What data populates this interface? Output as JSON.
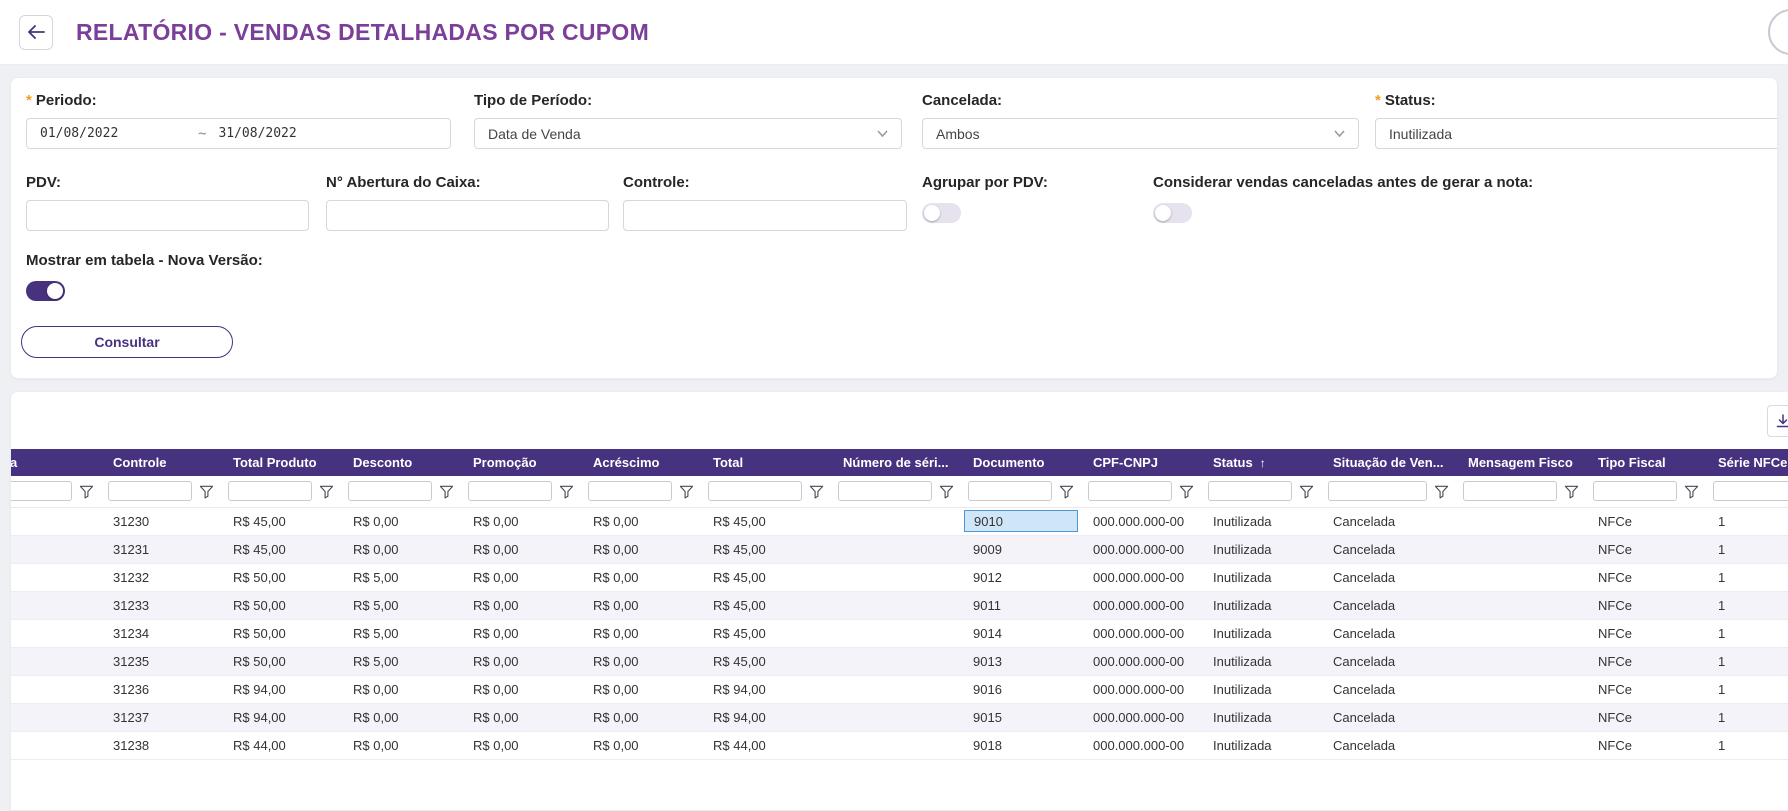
{
  "header": {
    "title": "RELATÓRIO - VENDAS DETALHADAS POR CUPOM"
  },
  "filters": {
    "required_mark": "*",
    "periodo": {
      "label": "Periodo:",
      "from": "01/08/2022",
      "separator": "~",
      "to": "31/08/2022"
    },
    "tipo_periodo": {
      "label": "Tipo de Período:",
      "value": "Data de Venda"
    },
    "cancelada": {
      "label": "Cancelada:",
      "value": "Ambos"
    },
    "status": {
      "label": "Status:",
      "value": "Inutilizada"
    },
    "pdv": {
      "label": "PDV:",
      "value": ""
    },
    "abertura_caixa": {
      "label": "N° Abertura do Caixa:",
      "value": ""
    },
    "controle": {
      "label": "Controle:",
      "value": ""
    },
    "agrupar_pdv": {
      "label": "Agrupar por PDV:",
      "enabled": false
    },
    "considerar_canceladas": {
      "label": "Considerar vendas canceladas antes de gerar a nota:",
      "enabled": false
    },
    "mostrar_tabela": {
      "label": "Mostrar em tabela - Nova Versão:",
      "enabled": true
    },
    "consultar_label": "Consultar"
  },
  "table": {
    "sort_arrow": "↑",
    "columns": [
      {
        "key": "abertura",
        "label": "Abertura"
      },
      {
        "key": "controle",
        "label": "Controle"
      },
      {
        "key": "total_produto",
        "label": "Total Produto"
      },
      {
        "key": "desconto",
        "label": "Desconto"
      },
      {
        "key": "promocao",
        "label": "Promoção"
      },
      {
        "key": "acrescimo",
        "label": "Acréscimo"
      },
      {
        "key": "total",
        "label": "Total"
      },
      {
        "key": "numero_serie",
        "label": "Número de séri..."
      },
      {
        "key": "documento",
        "label": "Documento"
      },
      {
        "key": "cpf_cnpj",
        "label": "CPF-CNPJ"
      },
      {
        "key": "status",
        "label": "Status",
        "sort": "asc"
      },
      {
        "key": "situacao_venda",
        "label": "Situação de Ven..."
      },
      {
        "key": "mensagem_fisco",
        "label": "Mensagem Fisco"
      },
      {
        "key": "tipo_fiscal",
        "label": "Tipo Fiscal"
      },
      {
        "key": "serie_nfce",
        "label": "Série NFCe"
      }
    ],
    "selected_cell": {
      "row_index": 0,
      "column_key": "documento"
    },
    "rows": [
      {
        "abertura": "",
        "controle": "31230",
        "total_produto": "R$ 45,00",
        "desconto": "R$ 0,00",
        "promocao": "R$ 0,00",
        "acrescimo": "R$ 0,00",
        "total": "R$ 45,00",
        "numero_serie": "",
        "documento": "9010",
        "cpf_cnpj": "000.000.000-00",
        "status": "Inutilizada",
        "situacao_venda": "Cancelada",
        "mensagem_fisco": "",
        "tipo_fiscal": "NFCe",
        "serie_nfce": "1"
      },
      {
        "abertura": "",
        "controle": "31231",
        "total_produto": "R$ 45,00",
        "desconto": "R$ 0,00",
        "promocao": "R$ 0,00",
        "acrescimo": "R$ 0,00",
        "total": "R$ 45,00",
        "numero_serie": "",
        "documento": "9009",
        "cpf_cnpj": "000.000.000-00",
        "status": "Inutilizada",
        "situacao_venda": "Cancelada",
        "mensagem_fisco": "",
        "tipo_fiscal": "NFCe",
        "serie_nfce": "1"
      },
      {
        "abertura": "",
        "controle": "31232",
        "total_produto": "R$ 50,00",
        "desconto": "R$ 5,00",
        "promocao": "R$ 0,00",
        "acrescimo": "R$ 0,00",
        "total": "R$ 45,00",
        "numero_serie": "",
        "documento": "9012",
        "cpf_cnpj": "000.000.000-00",
        "status": "Inutilizada",
        "situacao_venda": "Cancelada",
        "mensagem_fisco": "",
        "tipo_fiscal": "NFCe",
        "serie_nfce": "1"
      },
      {
        "abertura": "",
        "controle": "31233",
        "total_produto": "R$ 50,00",
        "desconto": "R$ 5,00",
        "promocao": "R$ 0,00",
        "acrescimo": "R$ 0,00",
        "total": "R$ 45,00",
        "numero_serie": "",
        "documento": "9011",
        "cpf_cnpj": "000.000.000-00",
        "status": "Inutilizada",
        "situacao_venda": "Cancelada",
        "mensagem_fisco": "",
        "tipo_fiscal": "NFCe",
        "serie_nfce": "1"
      },
      {
        "abertura": "",
        "controle": "31234",
        "total_produto": "R$ 50,00",
        "desconto": "R$ 5,00",
        "promocao": "R$ 0,00",
        "acrescimo": "R$ 0,00",
        "total": "R$ 45,00",
        "numero_serie": "",
        "documento": "9014",
        "cpf_cnpj": "000.000.000-00",
        "status": "Inutilizada",
        "situacao_venda": "Cancelada",
        "mensagem_fisco": "",
        "tipo_fiscal": "NFCe",
        "serie_nfce": "1"
      },
      {
        "abertura": "",
        "controle": "31235",
        "total_produto": "R$ 50,00",
        "desconto": "R$ 5,00",
        "promocao": "R$ 0,00",
        "acrescimo": "R$ 0,00",
        "total": "R$ 45,00",
        "numero_serie": "",
        "documento": "9013",
        "cpf_cnpj": "000.000.000-00",
        "status": "Inutilizada",
        "situacao_venda": "Cancelada",
        "mensagem_fisco": "",
        "tipo_fiscal": "NFCe",
        "serie_nfce": "1"
      },
      {
        "abertura": "",
        "controle": "31236",
        "total_produto": "R$ 94,00",
        "desconto": "R$ 0,00",
        "promocao": "R$ 0,00",
        "acrescimo": "R$ 0,00",
        "total": "R$ 94,00",
        "numero_serie": "",
        "documento": "9016",
        "cpf_cnpj": "000.000.000-00",
        "status": "Inutilizada",
        "situacao_venda": "Cancelada",
        "mensagem_fisco": "",
        "tipo_fiscal": "NFCe",
        "serie_nfce": "1"
      },
      {
        "abertura": "",
        "controle": "31237",
        "total_produto": "R$ 94,00",
        "desconto": "R$ 0,00",
        "promocao": "R$ 0,00",
        "acrescimo": "R$ 0,00",
        "total": "R$ 94,00",
        "numero_serie": "",
        "documento": "9015",
        "cpf_cnpj": "000.000.000-00",
        "status": "Inutilizada",
        "situacao_venda": "Cancelada",
        "mensagem_fisco": "",
        "tipo_fiscal": "NFCe",
        "serie_nfce": "1"
      },
      {
        "abertura": "",
        "controle": "31238",
        "total_produto": "R$ 44,00",
        "desconto": "R$ 0,00",
        "promocao": "R$ 0,00",
        "acrescimo": "R$ 0,00",
        "total": "R$ 44,00",
        "numero_serie": "",
        "documento": "9018",
        "cpf_cnpj": "000.000.000-00",
        "status": "Inutilizada",
        "situacao_venda": "Cancelada",
        "mensagem_fisco": "",
        "tipo_fiscal": "NFCe",
        "serie_nfce": "1"
      }
    ]
  },
  "colors": {
    "primary": "#46327f",
    "title": "#7b3e99",
    "selected_cell_bg": "#cfe6f8",
    "selected_cell_border": "#4f96d6",
    "row_alt": "#f5f3fa",
    "required": "#f59b22"
  }
}
